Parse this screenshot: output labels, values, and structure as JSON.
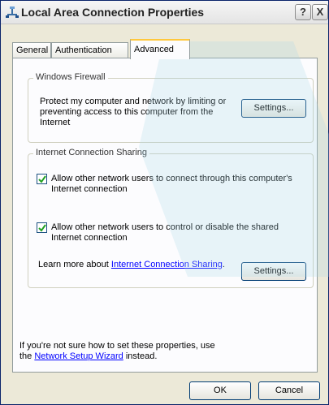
{
  "window": {
    "title": "Local Area Connection Properties",
    "help_label": "?",
    "close_label": "X"
  },
  "tabs": [
    {
      "label": "General",
      "active": false
    },
    {
      "label": "Authentication",
      "active": false
    },
    {
      "label": "Advanced",
      "active": true
    }
  ],
  "firewall": {
    "title": "Windows Firewall",
    "description": "Protect my computer and network by limiting or preventing access to this computer from the Internet",
    "settings_label": "Settings..."
  },
  "ics": {
    "title": "Internet Connection Sharing",
    "option1": {
      "checked": true,
      "label": "Allow other network users to connect through this computer's Internet connection"
    },
    "option2": {
      "checked": true,
      "label": "Allow other network users to control or disable the shared Internet connection"
    },
    "learn_prefix": "Learn more about ",
    "learn_link": "Internet Connection Sharing",
    "learn_suffix": ".",
    "settings_label": "Settings..."
  },
  "footer": {
    "line1": "If you're not sure how to set these properties, use",
    "line2_prefix": "the ",
    "wizard_link": "Network Setup Wizard",
    "line2_suffix": " instead."
  },
  "buttons": {
    "ok": "OK",
    "cancel": "Cancel"
  },
  "colors": {
    "dialog_bg": "#ECE9D8",
    "panel_bg": "#FCFCFE",
    "link": "#0000FF",
    "active_tab_accent": "#FFC83C",
    "watermark": "#A8D8E8"
  }
}
